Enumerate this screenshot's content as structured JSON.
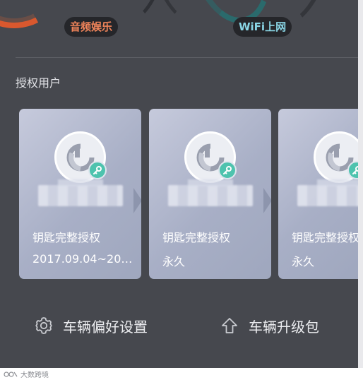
{
  "top_tiles": {
    "audio_label": "音频娱乐",
    "wifi_label": "WiFi上网",
    "audio_color": "#f0845a",
    "wifi_color": "#8ad6e6"
  },
  "authorized_users": {
    "section_title": "授权用户",
    "cards": [
      {
        "permission": "钥匙完整授权",
        "period": "2017.09.04~20…"
      },
      {
        "permission": "钥匙完整授权",
        "period": "永久"
      },
      {
        "permission": "钥匙完整授权",
        "period": "永久"
      }
    ],
    "badge_color": "#4ec3ae"
  },
  "actions": {
    "preference_label": "车辆偏好设置",
    "preference_icon": "gear-icon",
    "upgrade_label": "车辆升级包",
    "upgrade_icon": "upload-arrow-icon"
  },
  "watermark": {
    "text": "大数跨境"
  }
}
